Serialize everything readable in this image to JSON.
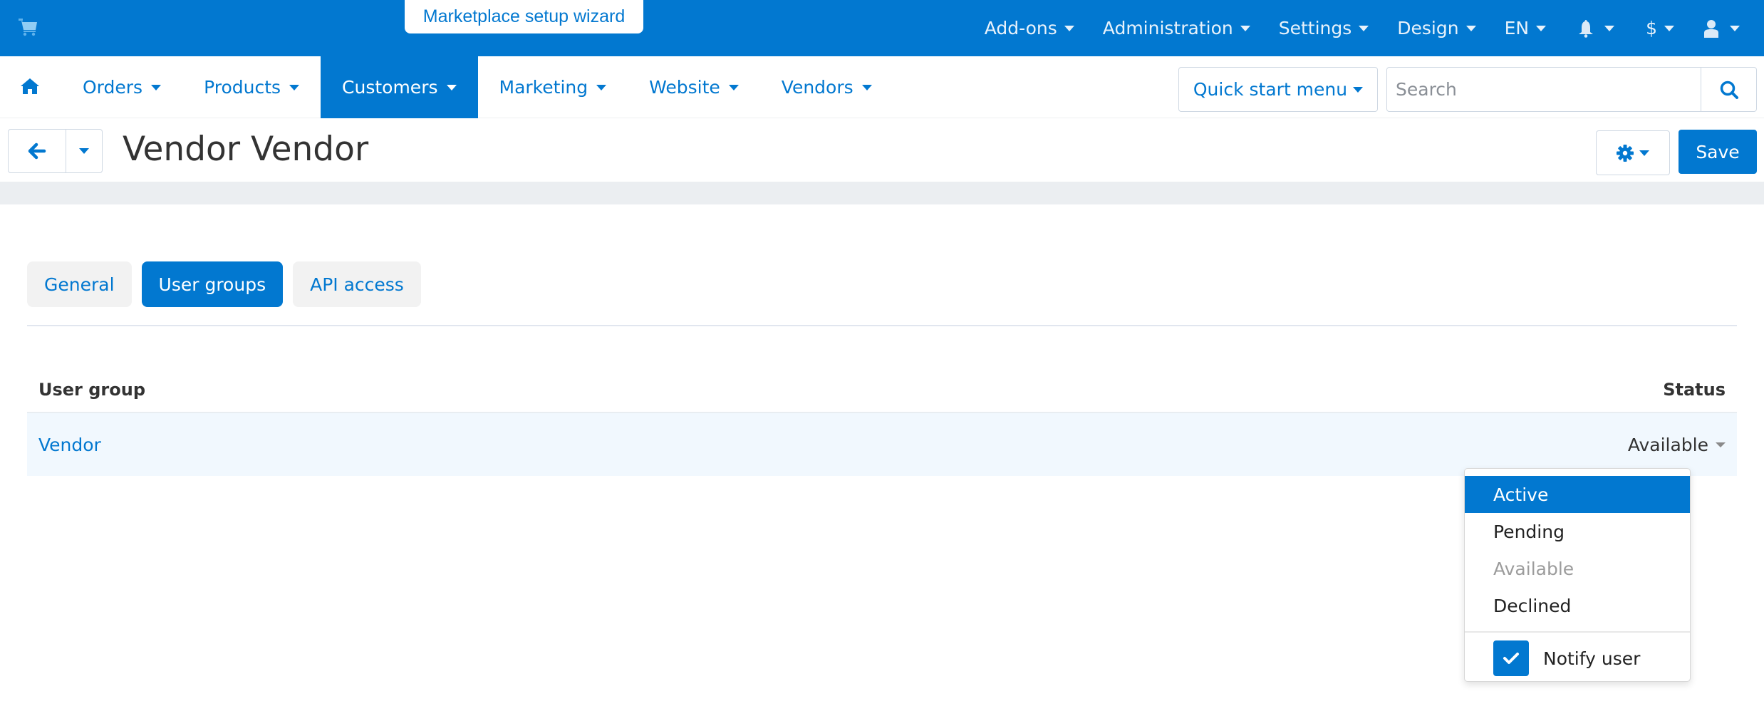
{
  "topbar": {
    "wizard_label": "Marketplace setup wizard",
    "menu": [
      {
        "label": "Add-ons"
      },
      {
        "label": "Administration"
      },
      {
        "label": "Settings"
      },
      {
        "label": "Design"
      },
      {
        "label": "EN"
      }
    ],
    "icons": [
      "cart-icon",
      "bell-icon",
      "currency-icon",
      "user-icon"
    ],
    "currency_symbol": "$"
  },
  "mainnav": {
    "items": [
      {
        "label": "Orders"
      },
      {
        "label": "Products"
      },
      {
        "label": "Customers",
        "active": true
      },
      {
        "label": "Marketing"
      },
      {
        "label": "Website"
      },
      {
        "label": "Vendors"
      }
    ],
    "quick_start_label": "Quick start menu",
    "search": {
      "placeholder": "Search",
      "value": ""
    }
  },
  "toolbar": {
    "page_title": "Vendor Vendor",
    "save_label": "Save"
  },
  "tabs": [
    {
      "label": "General"
    },
    {
      "label": "User groups",
      "active": true
    },
    {
      "label": "API access"
    }
  ],
  "table": {
    "headers": {
      "group": "User group",
      "status": "Status"
    },
    "rows": [
      {
        "group": "Vendor",
        "status": "Available"
      }
    ]
  },
  "status_dropdown": {
    "options": [
      {
        "label": "Active",
        "highlighted": true
      },
      {
        "label": "Pending"
      },
      {
        "label": "Available",
        "disabled": true
      },
      {
        "label": "Declined"
      }
    ],
    "notify_label": "Notify user",
    "notify_checked": true
  },
  "colors": {
    "brand": "#0278d0",
    "row_highlight": "#f1f8fe",
    "tab_inactive": "#f2f2f2"
  }
}
